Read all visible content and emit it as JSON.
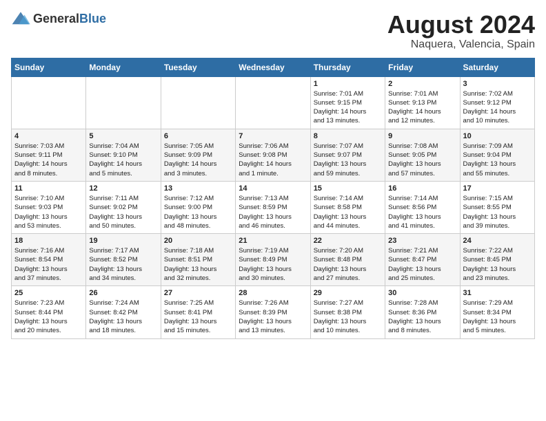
{
  "header": {
    "logo": {
      "general": "General",
      "blue": "Blue"
    },
    "title": "August 2024",
    "subtitle": "Naquera, Valencia, Spain"
  },
  "weekdays": [
    "Sunday",
    "Monday",
    "Tuesday",
    "Wednesday",
    "Thursday",
    "Friday",
    "Saturday"
  ],
  "weeks": [
    [
      {
        "day": "",
        "content": ""
      },
      {
        "day": "",
        "content": ""
      },
      {
        "day": "",
        "content": ""
      },
      {
        "day": "",
        "content": ""
      },
      {
        "day": "1",
        "content": "Sunrise: 7:01 AM\nSunset: 9:15 PM\nDaylight: 14 hours\nand 13 minutes."
      },
      {
        "day": "2",
        "content": "Sunrise: 7:01 AM\nSunset: 9:13 PM\nDaylight: 14 hours\nand 12 minutes."
      },
      {
        "day": "3",
        "content": "Sunrise: 7:02 AM\nSunset: 9:12 PM\nDaylight: 14 hours\nand 10 minutes."
      }
    ],
    [
      {
        "day": "4",
        "content": "Sunrise: 7:03 AM\nSunset: 9:11 PM\nDaylight: 14 hours\nand 8 minutes."
      },
      {
        "day": "5",
        "content": "Sunrise: 7:04 AM\nSunset: 9:10 PM\nDaylight: 14 hours\nand 5 minutes."
      },
      {
        "day": "6",
        "content": "Sunrise: 7:05 AM\nSunset: 9:09 PM\nDaylight: 14 hours\nand 3 minutes."
      },
      {
        "day": "7",
        "content": "Sunrise: 7:06 AM\nSunset: 9:08 PM\nDaylight: 14 hours\nand 1 minute."
      },
      {
        "day": "8",
        "content": "Sunrise: 7:07 AM\nSunset: 9:07 PM\nDaylight: 13 hours\nand 59 minutes."
      },
      {
        "day": "9",
        "content": "Sunrise: 7:08 AM\nSunset: 9:05 PM\nDaylight: 13 hours\nand 57 minutes."
      },
      {
        "day": "10",
        "content": "Sunrise: 7:09 AM\nSunset: 9:04 PM\nDaylight: 13 hours\nand 55 minutes."
      }
    ],
    [
      {
        "day": "11",
        "content": "Sunrise: 7:10 AM\nSunset: 9:03 PM\nDaylight: 13 hours\nand 53 minutes."
      },
      {
        "day": "12",
        "content": "Sunrise: 7:11 AM\nSunset: 9:02 PM\nDaylight: 13 hours\nand 50 minutes."
      },
      {
        "day": "13",
        "content": "Sunrise: 7:12 AM\nSunset: 9:00 PM\nDaylight: 13 hours\nand 48 minutes."
      },
      {
        "day": "14",
        "content": "Sunrise: 7:13 AM\nSunset: 8:59 PM\nDaylight: 13 hours\nand 46 minutes."
      },
      {
        "day": "15",
        "content": "Sunrise: 7:14 AM\nSunset: 8:58 PM\nDaylight: 13 hours\nand 44 minutes."
      },
      {
        "day": "16",
        "content": "Sunrise: 7:14 AM\nSunset: 8:56 PM\nDaylight: 13 hours\nand 41 minutes."
      },
      {
        "day": "17",
        "content": "Sunrise: 7:15 AM\nSunset: 8:55 PM\nDaylight: 13 hours\nand 39 minutes."
      }
    ],
    [
      {
        "day": "18",
        "content": "Sunrise: 7:16 AM\nSunset: 8:54 PM\nDaylight: 13 hours\nand 37 minutes."
      },
      {
        "day": "19",
        "content": "Sunrise: 7:17 AM\nSunset: 8:52 PM\nDaylight: 13 hours\nand 34 minutes."
      },
      {
        "day": "20",
        "content": "Sunrise: 7:18 AM\nSunset: 8:51 PM\nDaylight: 13 hours\nand 32 minutes."
      },
      {
        "day": "21",
        "content": "Sunrise: 7:19 AM\nSunset: 8:49 PM\nDaylight: 13 hours\nand 30 minutes."
      },
      {
        "day": "22",
        "content": "Sunrise: 7:20 AM\nSunset: 8:48 PM\nDaylight: 13 hours\nand 27 minutes."
      },
      {
        "day": "23",
        "content": "Sunrise: 7:21 AM\nSunset: 8:47 PM\nDaylight: 13 hours\nand 25 minutes."
      },
      {
        "day": "24",
        "content": "Sunrise: 7:22 AM\nSunset: 8:45 PM\nDaylight: 13 hours\nand 23 minutes."
      }
    ],
    [
      {
        "day": "25",
        "content": "Sunrise: 7:23 AM\nSunset: 8:44 PM\nDaylight: 13 hours\nand 20 minutes."
      },
      {
        "day": "26",
        "content": "Sunrise: 7:24 AM\nSunset: 8:42 PM\nDaylight: 13 hours\nand 18 minutes."
      },
      {
        "day": "27",
        "content": "Sunrise: 7:25 AM\nSunset: 8:41 PM\nDaylight: 13 hours\nand 15 minutes."
      },
      {
        "day": "28",
        "content": "Sunrise: 7:26 AM\nSunset: 8:39 PM\nDaylight: 13 hours\nand 13 minutes."
      },
      {
        "day": "29",
        "content": "Sunrise: 7:27 AM\nSunset: 8:38 PM\nDaylight: 13 hours\nand 10 minutes."
      },
      {
        "day": "30",
        "content": "Sunrise: 7:28 AM\nSunset: 8:36 PM\nDaylight: 13 hours\nand 8 minutes."
      },
      {
        "day": "31",
        "content": "Sunrise: 7:29 AM\nSunset: 8:34 PM\nDaylight: 13 hours\nand 5 minutes."
      }
    ]
  ]
}
